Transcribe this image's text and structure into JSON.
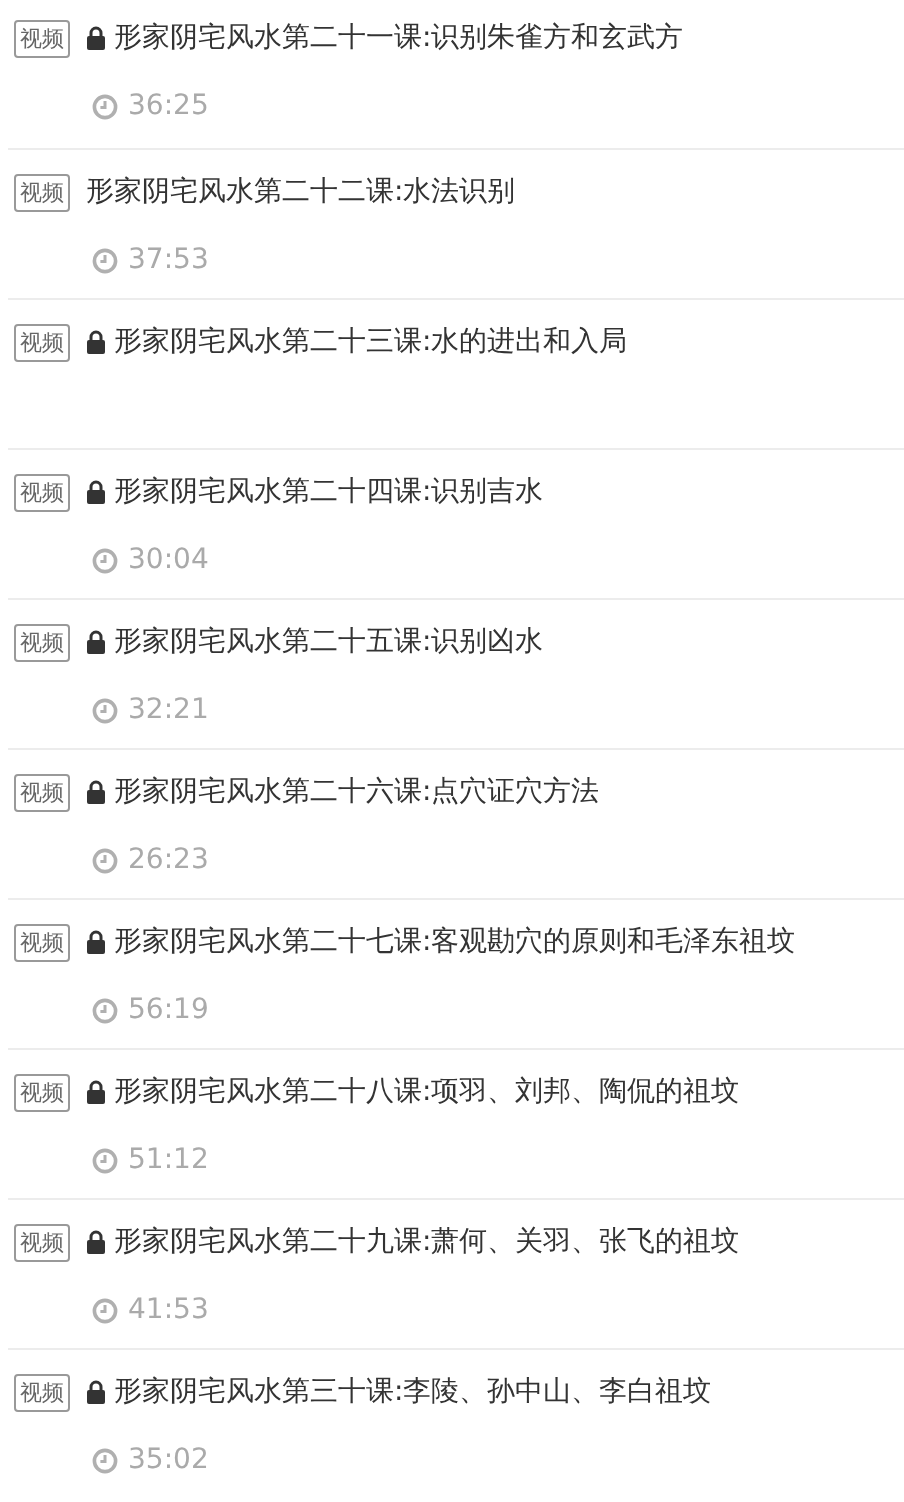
{
  "lessons": [
    {
      "badge": "视频",
      "locked": true,
      "title": "形家阴宅风水第二十一课:识别朱雀方和玄武方",
      "duration": "36:25"
    },
    {
      "badge": "视频",
      "locked": false,
      "title": "形家阴宅风水第二十二课:水法识别",
      "duration": "37:53"
    },
    {
      "badge": "视频",
      "locked": true,
      "title": "形家阴宅风水第二十三课:水的进出和入局"
    },
    {
      "badge": "视频",
      "locked": true,
      "title": "形家阴宅风水第二十四课:识别吉水",
      "duration": "30:04"
    },
    {
      "badge": "视频",
      "locked": true,
      "title": "形家阴宅风水第二十五课:识别凶水",
      "duration": "32:21"
    },
    {
      "badge": "视频",
      "locked": true,
      "title": "形家阴宅风水第二十六课:点穴证穴方法",
      "duration": "26:23"
    },
    {
      "badge": "视频",
      "locked": true,
      "title": "形家阴宅风水第二十七课:客观勘穴的原则和毛泽东祖坟",
      "duration": "56:19"
    },
    {
      "badge": "视频",
      "locked": true,
      "title": "形家阴宅风水第二十八课:项羽、刘邦、陶侃的祖坟",
      "duration": "51:12"
    },
    {
      "badge": "视频",
      "locked": true,
      "title": "形家阴宅风水第二十九课:萧何、关羽、张飞的祖坟",
      "duration": "41:53"
    },
    {
      "badge": "视频",
      "locked": true,
      "title": "形家阴宅风水第三十课:李陵、孙中山、李白祖坟",
      "duration": "35:02"
    }
  ]
}
